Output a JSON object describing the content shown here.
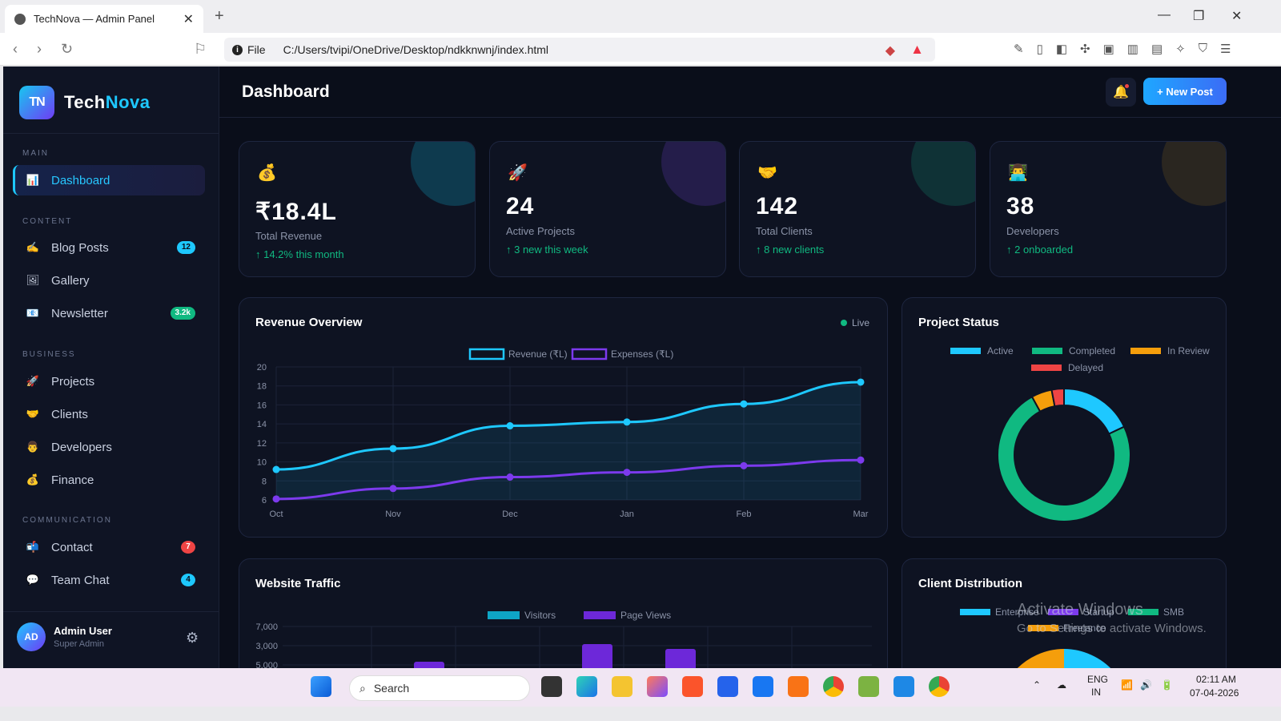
{
  "browser": {
    "tab_title": "TechNova — Admin Panel",
    "file_label": "File",
    "url": "C:/Users/tvipi/OneDrive/Desktop/ndkknwnj/index.html"
  },
  "sidebar": {
    "logo_mark": "TN",
    "logo_text_1": "Tech",
    "logo_text_2": "Nova",
    "sections": {
      "main": "MAIN",
      "content": "CONTENT",
      "business": "BUSINESS",
      "communication": "COMMUNICATION"
    },
    "items": {
      "dashboard": "Dashboard",
      "blog_posts": "Blog Posts",
      "blog_posts_badge": "12",
      "gallery": "Gallery",
      "newsletter": "Newsletter",
      "newsletter_badge": "3.2k",
      "projects": "Projects",
      "clients": "Clients",
      "developers": "Developers",
      "finance": "Finance",
      "contact": "Contact",
      "contact_badge": "7",
      "team_chat": "Team Chat",
      "team_chat_badge": "4"
    },
    "user": {
      "initials": "AD",
      "name": "Admin User",
      "role": "Super Admin"
    }
  },
  "header": {
    "title": "Dashboard",
    "new_post": "+ New Post"
  },
  "stats": [
    {
      "icon": "💰",
      "value": "₹18.4L",
      "label": "Total Revenue",
      "trend": "↑ 14.2% this month",
      "accent": "#0e3a4e"
    },
    {
      "icon": "🚀",
      "value": "24",
      "label": "Active Projects",
      "trend": "↑ 3 new this week",
      "accent": "#241d4a"
    },
    {
      "icon": "🤝",
      "value": "142",
      "label": "Total Clients",
      "trend": "↑ 8 new clients",
      "accent": "#0f3236"
    },
    {
      "icon": "👨‍💻",
      "value": "38",
      "label": "Developers",
      "trend": "↑ 2 onboarded",
      "accent": "#2a2620"
    }
  ],
  "revenue_card": {
    "title": "Revenue Overview",
    "live": "Live"
  },
  "status_card": {
    "title": "Project Status"
  },
  "traffic_card": {
    "title": "Website Traffic"
  },
  "clients_card": {
    "title": "Client Distribution"
  },
  "watermark": {
    "line1": "Activate Windows",
    "line2": "Go to Settings to activate Windows."
  },
  "taskbar": {
    "search": "Search",
    "lang1": "ENG",
    "lang2": "IN",
    "time": "02:11 AM",
    "date": "07-04-2026"
  },
  "colors": {
    "accent": "#1ec8ff",
    "purple": "#7c3aed",
    "green": "#10b981",
    "orange": "#f59e0b",
    "red": "#ef4444"
  },
  "chart_data": [
    {
      "type": "area",
      "title": "Revenue Overview",
      "categories": [
        "Oct",
        "Nov",
        "Dec",
        "Jan",
        "Feb",
        "Mar"
      ],
      "ylim": [
        6,
        20
      ],
      "yticks": [
        6,
        8,
        10,
        12,
        14,
        16,
        18,
        20
      ],
      "series": [
        {
          "name": "Revenue (₹L)",
          "color": "#1ec8ff",
          "values": [
            9.2,
            11.4,
            13.8,
            14.2,
            16.1,
            18.4
          ]
        },
        {
          "name": "Expenses (₹L)",
          "color": "#7c3aed",
          "values": [
            6.1,
            7.2,
            8.4,
            8.9,
            9.6,
            10.2
          ]
        }
      ],
      "legend": "top"
    },
    {
      "type": "pie",
      "title": "Project Status",
      "labels": [
        "Active",
        "Completed",
        "In Review",
        "Delayed"
      ],
      "values": [
        18,
        74,
        5,
        3
      ],
      "colors": [
        "#1ec8ff",
        "#10b981",
        "#f59e0b",
        "#ef4444"
      ],
      "legend": "top"
    },
    {
      "type": "bar",
      "title": "Website Traffic",
      "series": [
        {
          "name": "Visitors",
          "color": "#0ea5c6"
        },
        {
          "name": "Page Views",
          "color": "#6d28d9"
        }
      ],
      "yticks": [
        "7,000",
        "3,000",
        "5,000"
      ],
      "legend": "top"
    },
    {
      "type": "pie",
      "title": "Client Distribution",
      "labels": [
        "Enterprise",
        "Startup",
        "SMB",
        "Freelance"
      ],
      "colors": [
        "#1ec8ff",
        "#7c3aed",
        "#10b981",
        "#f59e0b"
      ],
      "legend": "top"
    }
  ]
}
